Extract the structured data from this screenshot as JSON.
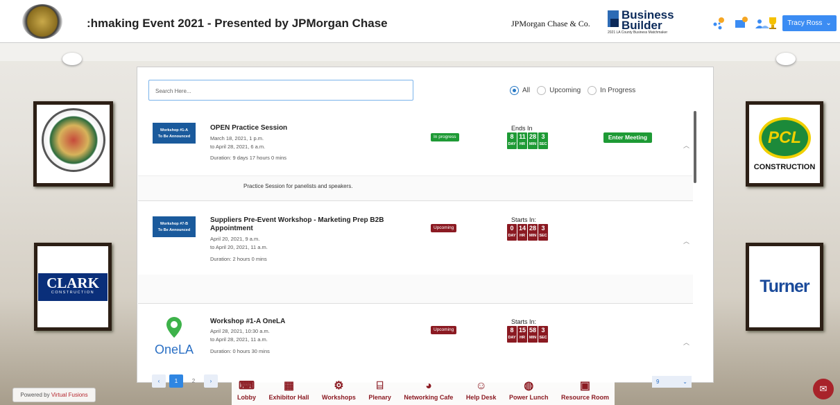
{
  "header": {
    "event_title": ":hmaking Event 2021 - Presented by JPMorgan Chase",
    "sponsor": "JPMorgan Chase & Co.",
    "bb_title": "Business\nBuilder",
    "bb_sub": "2021 LA County Business Matchmaker",
    "user": "Tracy Ross"
  },
  "search": {
    "placeholder": "Search Here..."
  },
  "filter": {
    "options": [
      "All",
      "Upcoming",
      "In Progress"
    ],
    "selected": "All"
  },
  "sessions": [
    {
      "thumb": "Workshop #1-A\nTo Be Announced",
      "title": "OPEN Practice Session",
      "line1": "March 18, 2021, 1 p.m.",
      "line2": "to April 28, 2021, 6 a.m.",
      "duration": "Duration: 9 days 17 hours 0 mins",
      "status": "In progress",
      "cd_label": "Ends In",
      "cd": [
        "8",
        "11",
        "28",
        "3"
      ],
      "action": "Enter Meeting",
      "desc": "Practice Session for panelists and speakers."
    },
    {
      "thumb": "Workshop #7-B\nTo Be Announced",
      "title": "Suppliers Pre-Event Workshop - Marketing Prep B2B Appointment",
      "line1": "April 20, 2021, 9 a.m.",
      "line2": "to April 20, 2021, 11 a.m.",
      "duration": "Duration: 2 hours 0 mins",
      "status": "Upcoming",
      "cd_label": "Starts In:",
      "cd": [
        "0",
        "14",
        "28",
        "3"
      ]
    },
    {
      "thumb": "OneLA",
      "title": "Workshop #1-A OneLA",
      "line1": "April 28, 2021, 10:30 a.m.",
      "line2": "to April 28, 2021, 11 a.m.",
      "duration": "Duration: 0 hours 30 mins",
      "status": "Upcoming",
      "cd_label": "Starts In:",
      "cd": [
        "8",
        "15",
        "58",
        "3"
      ]
    }
  ],
  "cd_units": [
    "DAY",
    "HR",
    "MIN",
    "SEC"
  ],
  "pager": {
    "pages": [
      "1",
      "2"
    ],
    "current": "1",
    "per_page": "9"
  },
  "nav": [
    "Lobby",
    "Exhibitor Hall",
    "Workshops",
    "Plenary",
    "Networking Cafe",
    "Help Desk",
    "Power Lunch",
    "Resource Room"
  ],
  "sponsor_frames": {
    "clark_main": "CLARK",
    "clark_sub": "CONSTRUCTION",
    "pcl_main": "PCL",
    "pcl_sub": "CONSTRUCTION",
    "turner": "Turner"
  },
  "footer": {
    "powered_prefix": "Powered by ",
    "powered_name": "Virtual Fusions"
  }
}
